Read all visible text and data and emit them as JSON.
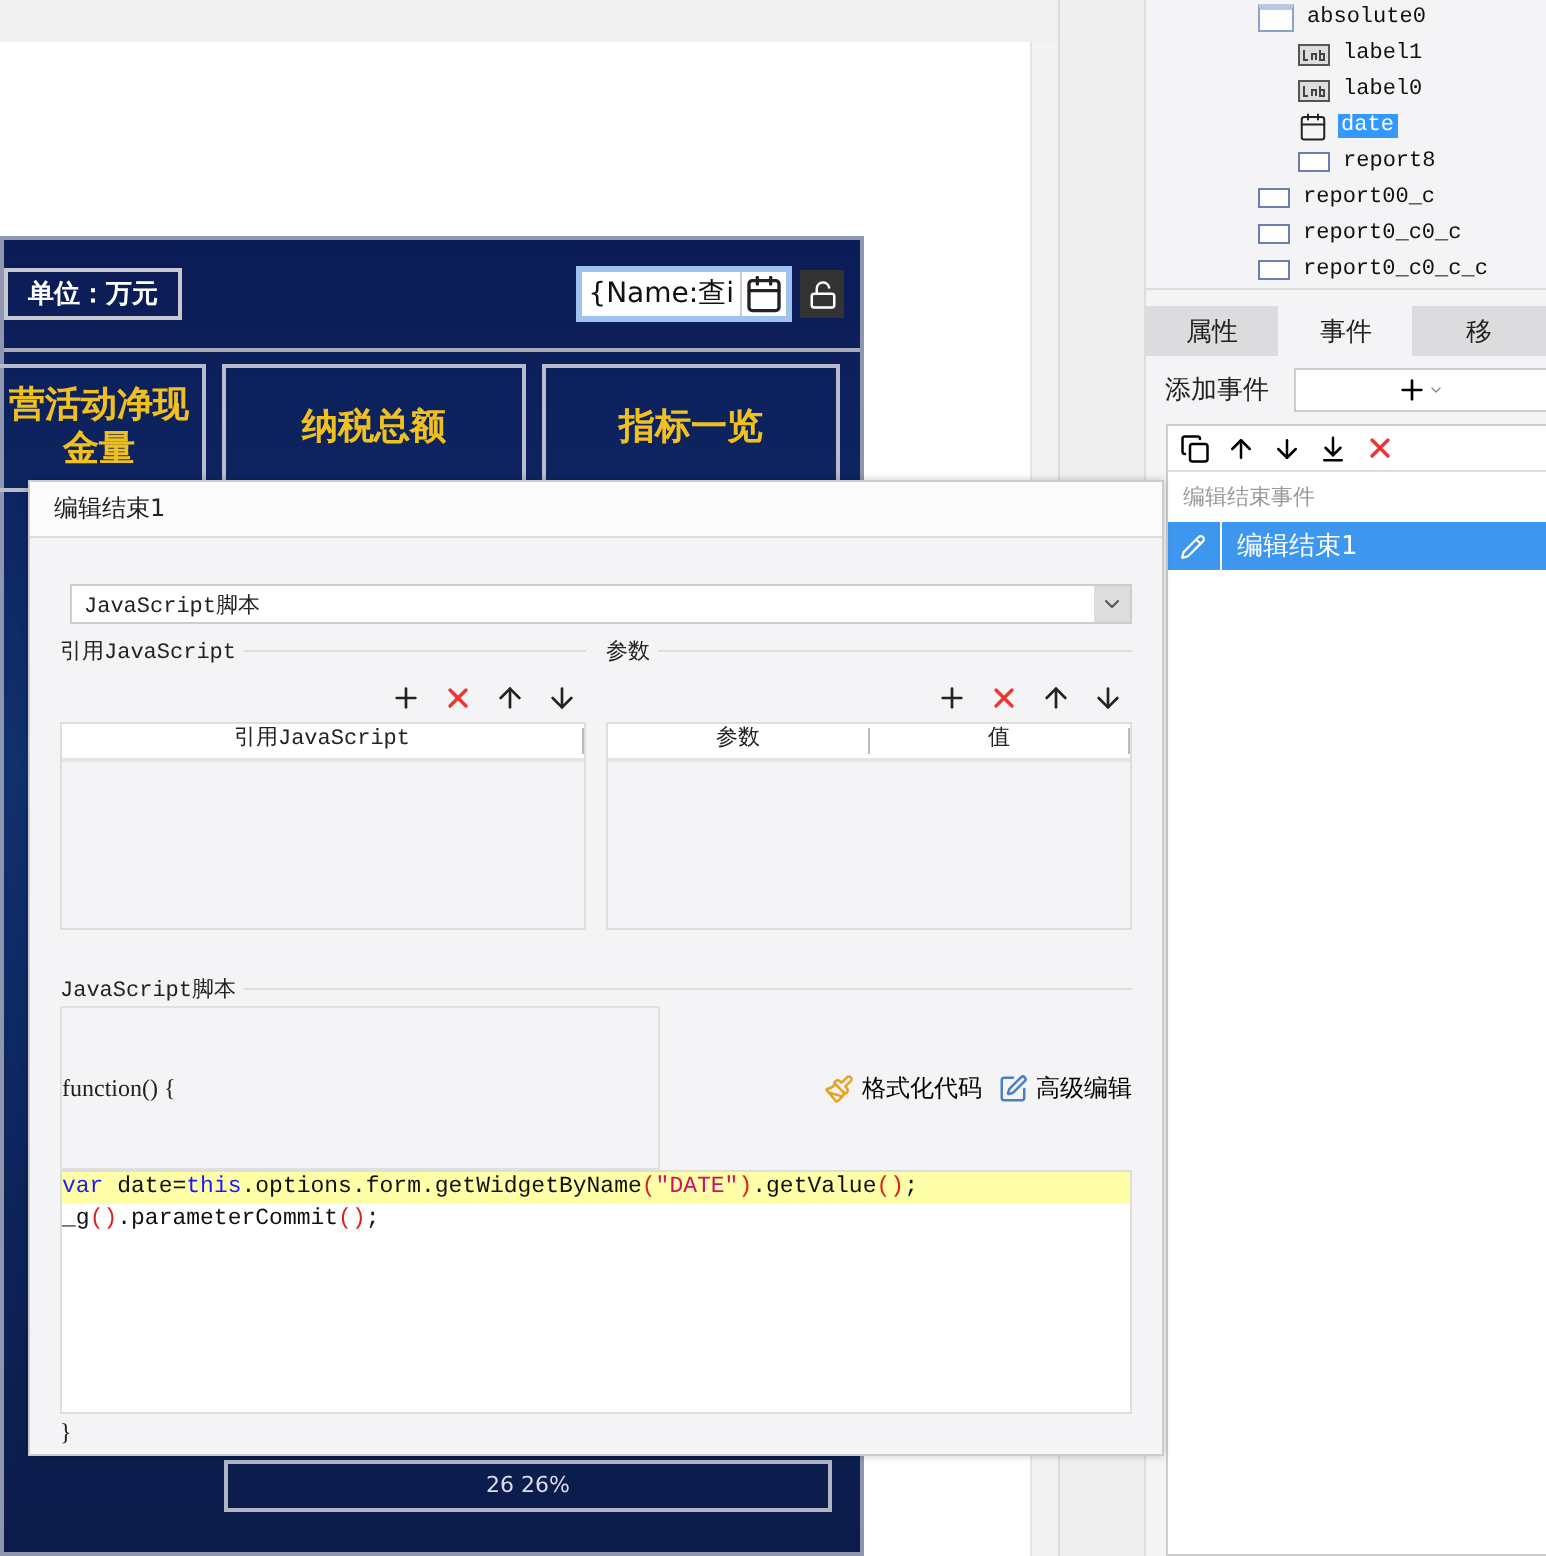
{
  "canvas": {
    "unit_label": "单位：万元",
    "date_field": {
      "value": "{Name:查i"
    },
    "cards": [
      {
        "title": "营活动净现金量"
      },
      {
        "title": "纳税总额"
      },
      {
        "title": "指标一览"
      }
    ],
    "bottom_text": "26   26%"
  },
  "tree": {
    "items": [
      {
        "label": "absolute0",
        "kind": "absolute",
        "selected": false,
        "children": [
          {
            "label": "label1",
            "kind": "label",
            "selected": false
          },
          {
            "label": "label0",
            "kind": "label",
            "selected": false
          },
          {
            "label": "date",
            "kind": "date",
            "selected": true
          },
          {
            "label": "report8",
            "kind": "report",
            "selected": false
          }
        ]
      },
      {
        "label": "report00_c",
        "kind": "report",
        "selected": false
      },
      {
        "label": "report0_c0_c",
        "kind": "report",
        "selected": false
      },
      {
        "label": "report0_c0_c_c",
        "kind": "report",
        "selected": false
      }
    ]
  },
  "panel_tabs": [
    {
      "label": "属性",
      "selected": false
    },
    {
      "label": "事件",
      "selected": true
    },
    {
      "label": "移",
      "selected": false
    }
  ],
  "events": {
    "add_label": "添加事件",
    "list_header": "编辑结束事件",
    "items": [
      {
        "label": "编辑结束1",
        "selected": true
      }
    ]
  },
  "dialog": {
    "title": "编辑结束1",
    "type_select": {
      "value": "JavaScript脚本"
    },
    "imports": {
      "title": "引用JavaScript",
      "columns": [
        "引用JavaScript"
      ]
    },
    "params": {
      "title": "参数",
      "columns": [
        "参数",
        "值"
      ]
    },
    "script": {
      "title": "JavaScript脚本",
      "header": "function() {",
      "format_button": "格式化代码",
      "advanced_button": "高级编辑",
      "lines": [
        {
          "current": true,
          "tokens": [
            {
              "kind": "keyword",
              "text": "var"
            },
            {
              "kind": "plain",
              "text": " date="
            },
            {
              "kind": "keyword",
              "text": "this"
            },
            {
              "kind": "plain",
              "text": ".options.form.getWidgetByName"
            },
            {
              "kind": "paren",
              "text": "("
            },
            {
              "kind": "string",
              "text": "\"DATE\""
            },
            {
              "kind": "paren",
              "text": ")"
            },
            {
              "kind": "plain",
              "text": ".getValue"
            },
            {
              "kind": "paren",
              "text": "()"
            },
            {
              "kind": "plain",
              "text": ";"
            }
          ]
        },
        {
          "current": false,
          "tokens": [
            {
              "kind": "plain",
              "text": "_g"
            },
            {
              "kind": "paren",
              "text": "()"
            },
            {
              "kind": "plain",
              "text": ".parameterCommit"
            },
            {
              "kind": "paren",
              "text": "()"
            },
            {
              "kind": "plain",
              "text": ";"
            }
          ]
        }
      ],
      "footer": "}"
    }
  }
}
